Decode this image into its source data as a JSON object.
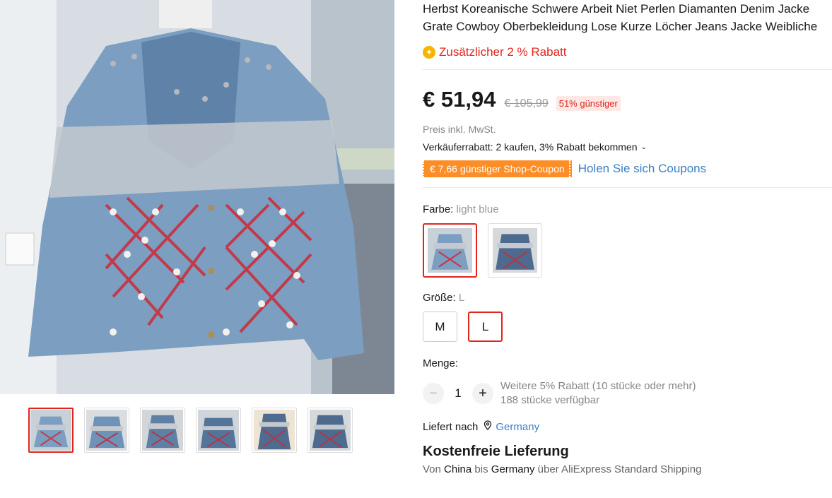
{
  "product": {
    "title_line1": "Herbst Koreanische Schwere Arbeit Niet Perlen Diamanten Denim Jacke",
    "title_line2": "Grate Cowboy Oberbekleidung Lose Kurze Löcher Jeans Jacke Weibliche"
  },
  "promo": {
    "extra_discount": "Zusätzlicher 2 % Rabatt",
    "icon": "star-coin-icon"
  },
  "pricing": {
    "price": "€ 51,94",
    "old_price": "€ 105,99",
    "discount": "51% günstiger",
    "tax_note": "Preis inkl. MwSt.",
    "seller_discount": "Verkäuferrabatt: 2 kaufen, 3% Rabatt bekommen",
    "coupon": "€ 7,66 günstiger Shop-Coupon",
    "coupon_link": "Holen Sie sich Coupons"
  },
  "color": {
    "label": "Farbe:",
    "selected": "light blue",
    "options": [
      "light blue",
      "dark blue"
    ]
  },
  "size": {
    "label": "Größe:",
    "selected": "L",
    "options": [
      "M",
      "L"
    ]
  },
  "quantity": {
    "label": "Menge:",
    "value": "1",
    "minus": "−",
    "plus": "+",
    "bulk_discount": "Weitere 5% Rabatt (10 stücke oder mehr)",
    "available": "188 stücke verfügbar"
  },
  "shipping": {
    "deliver_to_label": "Liefert nach",
    "country": "Germany",
    "free_label": "Kostenfreie Lieferung",
    "route_from_prefix": "Von",
    "route_from": "China",
    "route_to_prefix": "bis",
    "route_to": "Germany",
    "route_suffix": "über AliExpress Standard Shipping"
  },
  "gallery": {
    "thumbnail_count": 6,
    "active_index": 0
  },
  "colors": {
    "accent": "#e1251b",
    "coupon": "#fd8d27",
    "link": "#3a7fc4"
  }
}
